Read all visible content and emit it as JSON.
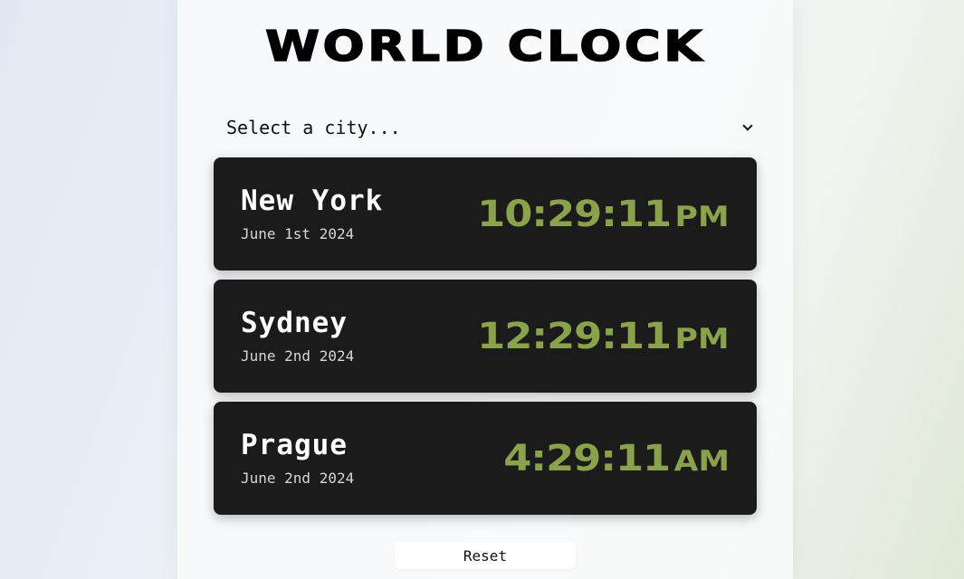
{
  "header": {
    "title": "WORLD CLOCK"
  },
  "city_select": {
    "selected": "Select a city...",
    "icon": "chevron-down-icon"
  },
  "clocks": [
    {
      "city": "New York",
      "date": "June 1st 2024",
      "time": "10:29:11",
      "period": "PM"
    },
    {
      "city": "Sydney",
      "date": "June 2nd 2024",
      "time": "12:29:11",
      "period": "PM"
    },
    {
      "city": "Prague",
      "date": "June 2nd 2024",
      "time": "4:29:11",
      "period": "AM"
    }
  ],
  "reset_label": "Reset",
  "colors": {
    "card_bg": "#1b1b1b",
    "time_accent": "#8aa24a",
    "title": "#000000"
  }
}
